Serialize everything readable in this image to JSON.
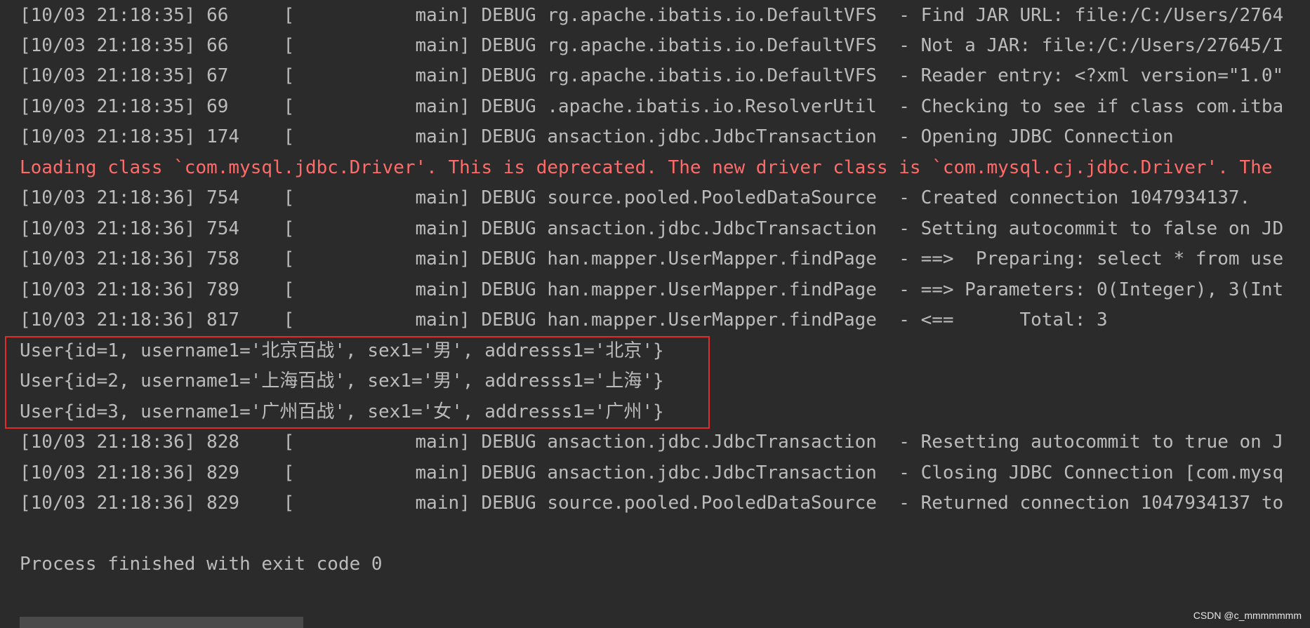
{
  "console": {
    "lines": [
      "[10/03 21:18:35] 66     [           main] DEBUG rg.apache.ibatis.io.DefaultVFS  - Find JAR URL: file:/C:/Users/2764",
      "[10/03 21:18:35] 66     [           main] DEBUG rg.apache.ibatis.io.DefaultVFS  - Not a JAR: file:/C:/Users/27645/I",
      "[10/03 21:18:35] 67     [           main] DEBUG rg.apache.ibatis.io.DefaultVFS  - Reader entry: <?xml version=\"1.0\"",
      "[10/03 21:18:35] 69     [           main] DEBUG .apache.ibatis.io.ResolverUtil  - Checking to see if class com.itba",
      "[10/03 21:18:35] 174    [           main] DEBUG ansaction.jdbc.JdbcTransaction  - Opening JDBC Connection",
      "Loading class `com.mysql.jdbc.Driver'. This is deprecated. The new driver class is `com.mysql.cj.jdbc.Driver'. The",
      "[10/03 21:18:36] 754    [           main] DEBUG source.pooled.PooledDataSource  - Created connection 1047934137.",
      "[10/03 21:18:36] 754    [           main] DEBUG ansaction.jdbc.JdbcTransaction  - Setting autocommit to false on JD",
      "[10/03 21:18:36] 758    [           main] DEBUG han.mapper.UserMapper.findPage  - ==>  Preparing: select * from use",
      "[10/03 21:18:36] 789    [           main] DEBUG han.mapper.UserMapper.findPage  - ==> Parameters: 0(Integer), 3(Int",
      "[10/03 21:18:36] 817    [           main] DEBUG han.mapper.UserMapper.findPage  - <==      Total: 3",
      "User{id=1, username1='北京百战', sex1='男', addresss1='北京'}",
      "User{id=2, username1='上海百战', sex1='男', addresss1='上海'}",
      "User{id=3, username1='广州百战', sex1='女', addresss1='广州'}",
      "[10/03 21:18:36] 828    [           main] DEBUG ansaction.jdbc.JdbcTransaction  - Resetting autocommit to true on J",
      "[10/03 21:18:36] 829    [           main] DEBUG ansaction.jdbc.JdbcTransaction  - Closing JDBC Connection [com.mysq",
      "[10/03 21:18:36] 829    [           main] DEBUG source.pooled.PooledDataSource  - Returned connection 1047934137 to"
    ],
    "process_finished": "Process finished with exit code 0"
  },
  "colors": {
    "background": "#2b2b2b",
    "text": "#bbbbbb",
    "stderr": "#ff6b68",
    "highlight_border": "#e02b2b"
  },
  "watermark": "CSDN @c_mmmmmmm"
}
